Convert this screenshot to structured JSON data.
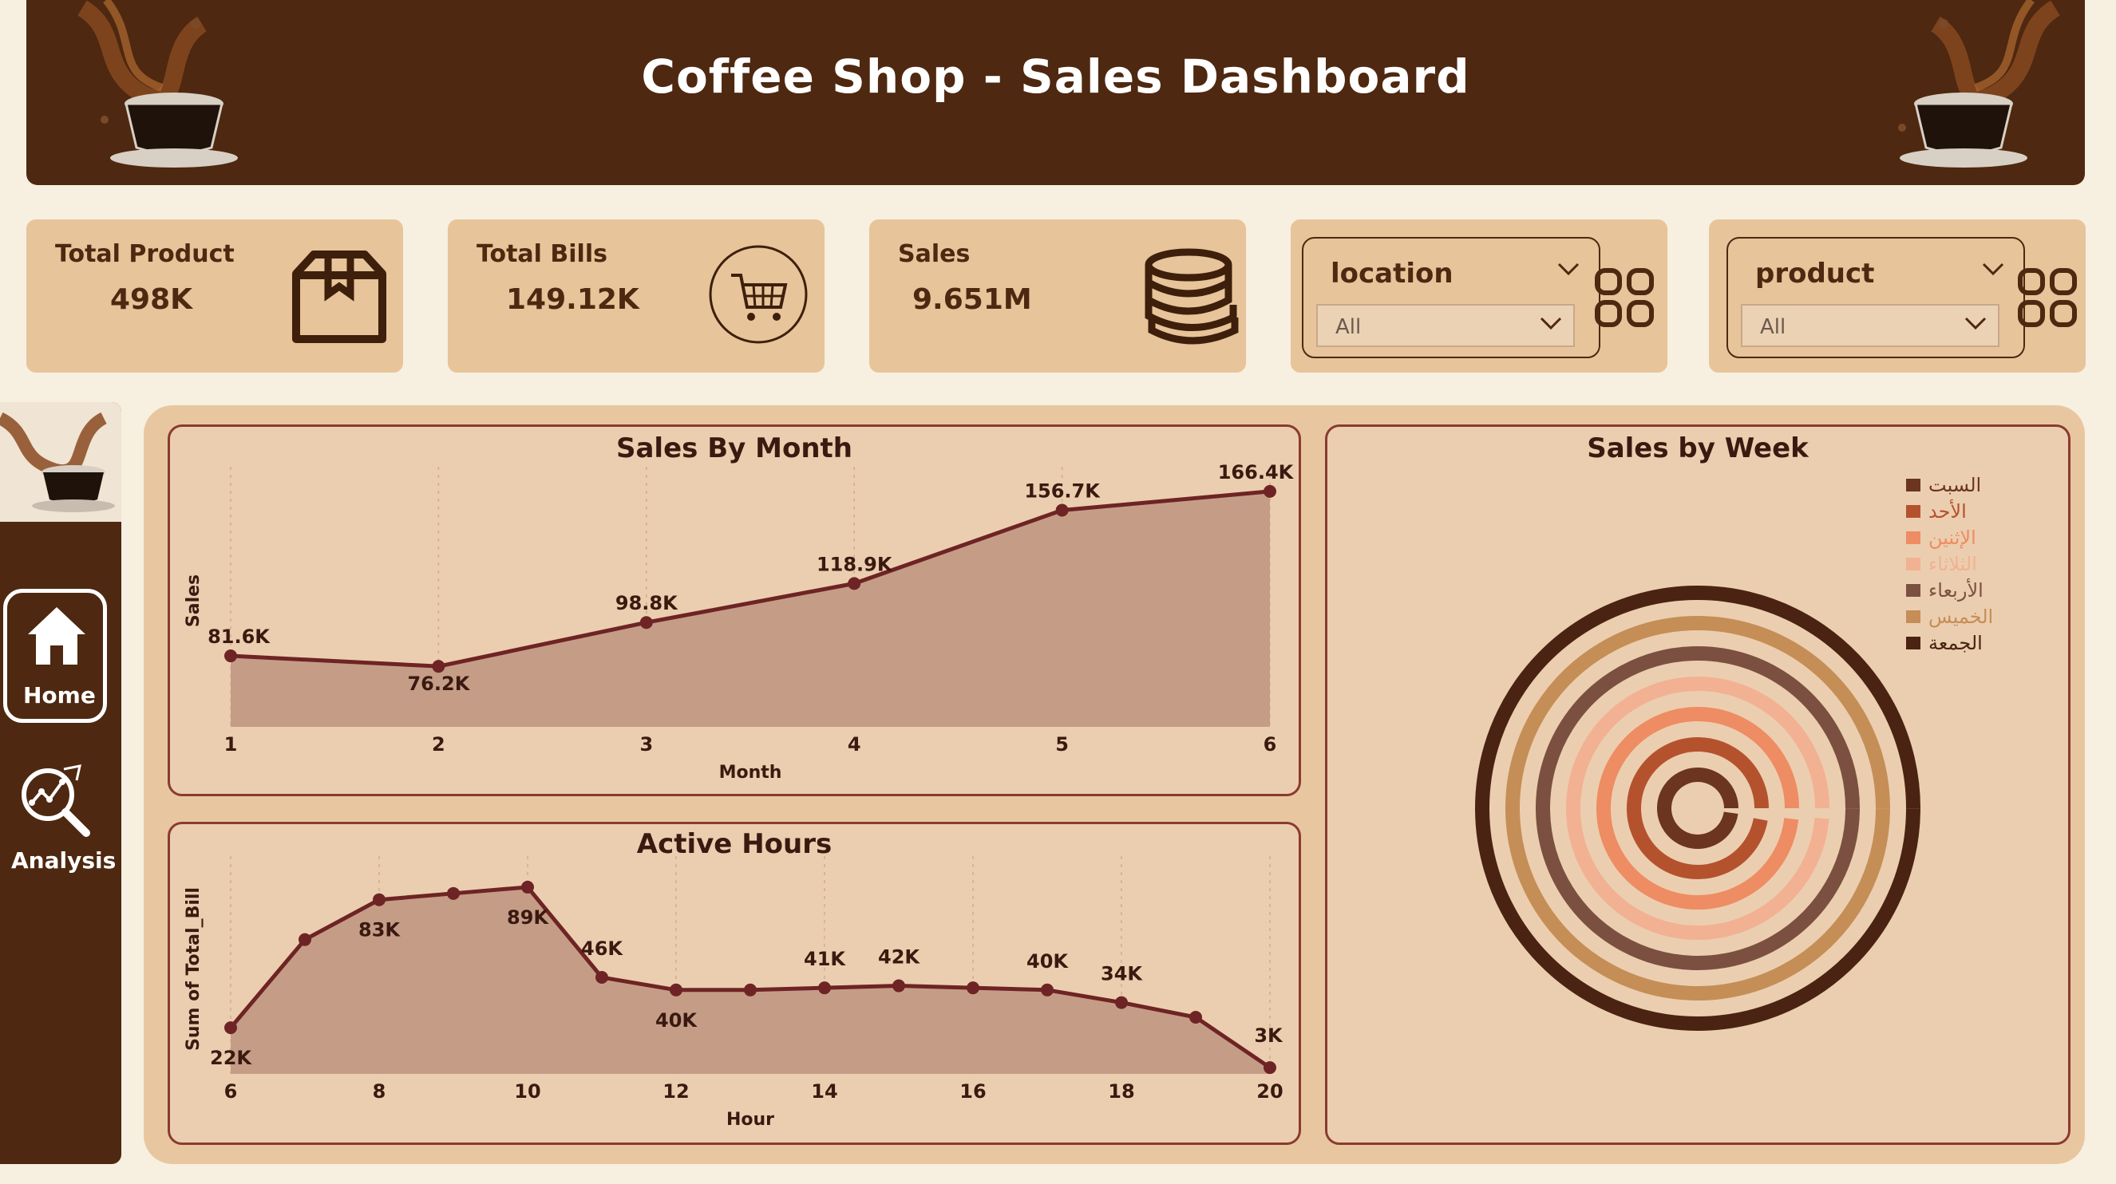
{
  "header": {
    "title": "Coffee Shop - Sales Dashboard"
  },
  "kpis": [
    {
      "label": "Total Product",
      "value": "498K",
      "icon": "box-icon"
    },
    {
      "label": "Total Bills",
      "value": "149.12K",
      "icon": "cart-icon"
    },
    {
      "label": "Sales",
      "value": "9.651M",
      "icon": "coins-icon"
    }
  ],
  "slicers": [
    {
      "title": "location",
      "selected": "All"
    },
    {
      "title": "product",
      "selected": "All"
    }
  ],
  "nav": {
    "home": "Home",
    "analysis": "Analysis"
  },
  "colors": {
    "brown": "#4e2810",
    "line": "#6e2424",
    "area": "#c39a85",
    "panel": "#ebceaf"
  },
  "chart_data": [
    {
      "type": "area",
      "title": "Sales By Month",
      "xlabel": "Month",
      "ylabel": "Sales",
      "x": [
        1,
        2,
        3,
        4,
        5,
        6
      ],
      "values": [
        81.6,
        76.2,
        98.8,
        118.9,
        156.7,
        166.4
      ],
      "labels": [
        "81.6K",
        "76.2K",
        "98.8K",
        "118.9K",
        "156.7K",
        "166.4K"
      ],
      "xticks": [
        "1",
        "2",
        "3",
        "4",
        "5",
        "6"
      ],
      "ylim": [
        45,
        175
      ]
    },
    {
      "type": "area",
      "title": "Active Hours",
      "xlabel": "Hour",
      "ylabel": "Sum of Total_Bill",
      "x": [
        6,
        7,
        8,
        9,
        10,
        11,
        12,
        13,
        14,
        15,
        16,
        17,
        18,
        19,
        20
      ],
      "values": [
        22,
        64,
        83,
        86,
        89,
        46,
        40,
        40,
        41,
        42,
        41,
        40,
        34,
        27,
        3
      ],
      "labels": [
        "22K",
        "",
        "83K",
        "",
        "89K",
        "46K",
        "40K",
        "",
        "41K",
        "42K",
        "",
        "40K",
        "34K",
        "",
        "3K"
      ],
      "xticks": [
        "6",
        "8",
        "10",
        "12",
        "14",
        "16",
        "18",
        "20"
      ],
      "ylim": [
        0,
        100
      ]
    },
    {
      "type": "radial-bar",
      "title": "Sales by Week",
      "series": [
        {
          "name": "السبت",
          "color": "#6b3520",
          "fraction": 0.978
        },
        {
          "name": "الأحد",
          "color": "#b5522e",
          "fraction": 0.972
        },
        {
          "name": "الإثنين",
          "color": "#ee8c63",
          "fraction": 0.982
        },
        {
          "name": "الثلاثاء",
          "color": "#f2b193",
          "fraction": 0.987
        },
        {
          "name": "الأربعاء",
          "color": "#7b5040",
          "fraction": 1.0
        },
        {
          "name": "الخميس",
          "color": "#c58e56",
          "fraction": 1.0
        },
        {
          "name": "الجمعة",
          "color": "#4a2312",
          "fraction": 1.0
        }
      ]
    }
  ]
}
